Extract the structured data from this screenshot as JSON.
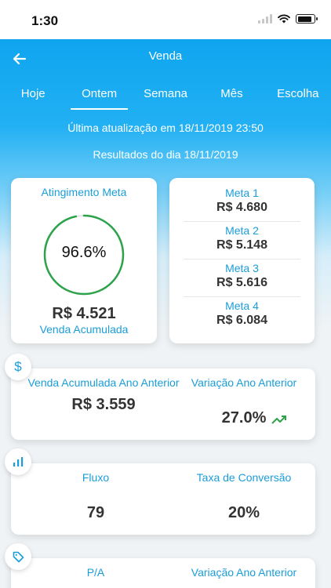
{
  "status_bar": {
    "time": "1:30"
  },
  "nav": {
    "title": "Venda"
  },
  "tabs": [
    {
      "label": "Hoje",
      "active": false
    },
    {
      "label": "Ontem",
      "active": true
    },
    {
      "label": "Semana",
      "active": false
    },
    {
      "label": "Mês",
      "active": false
    },
    {
      "label": "Escolha",
      "active": false
    }
  ],
  "info": {
    "last_update": "Última atualização em 18/11/2019 23:50",
    "results": "Resultados do dia 18/11/2019"
  },
  "goal_card": {
    "title": "Atingimento Meta",
    "percent_text": "96.6%",
    "percent_value": 96.6,
    "amount": "R$ 4.521",
    "subtitle": "Venda Acumulada",
    "ring_color": "#2ca24a"
  },
  "targets": [
    {
      "label": "Meta 1",
      "value": "R$ 4.680"
    },
    {
      "label": "Meta 2",
      "value": "R$ 5.148"
    },
    {
      "label": "Meta 3",
      "value": "R$ 5.616"
    },
    {
      "label": "Meta 4",
      "value": "R$ 6.084"
    }
  ],
  "sales_card": {
    "icon": "dollar-icon",
    "left_label": "Venda Acumulada Ano Anterior",
    "left_value": "R$ 3.559",
    "right_label": "Variação Ano Anterior",
    "right_value": "27.0%",
    "trend_icon": "trending-up-icon",
    "trend_color": "#2ca24a"
  },
  "flow_card": {
    "icon": "bar-chart-icon",
    "left_label": "Fluxo",
    "left_value": "79",
    "right_label": "Taxa de Conversão",
    "right_value": "20%"
  },
  "pa_card": {
    "icon": "tag-icon",
    "left_label": "P/A",
    "right_label": "Variação Ano Anterior"
  }
}
